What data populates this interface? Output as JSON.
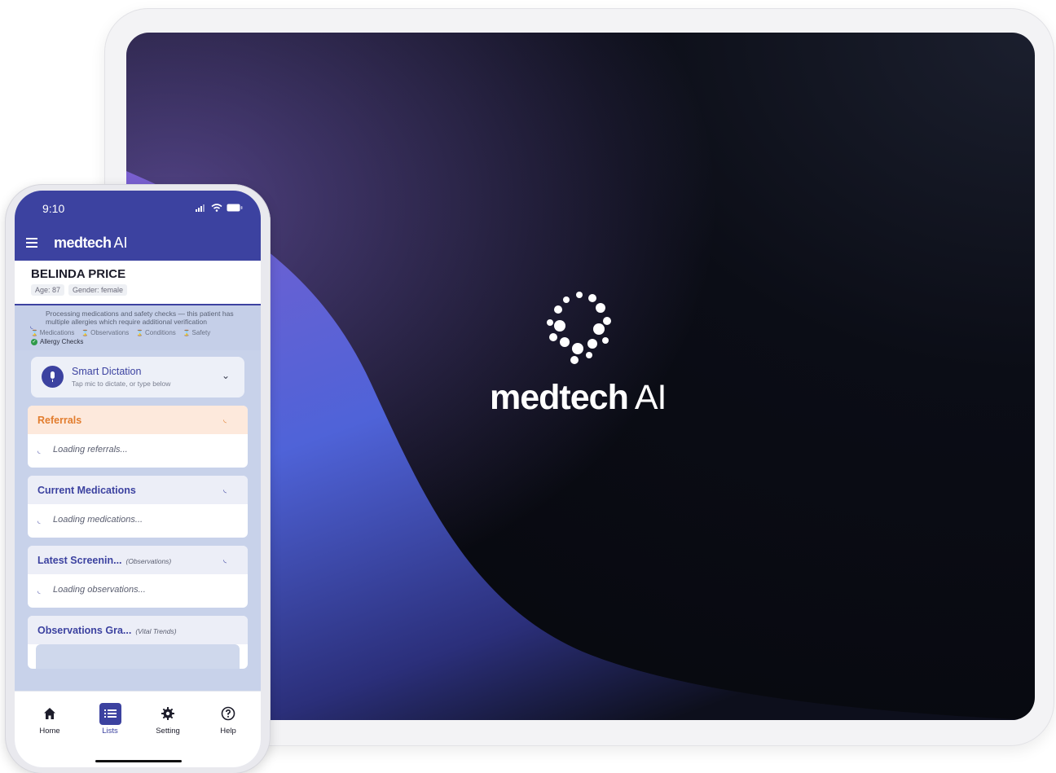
{
  "splash": {
    "brand_bold": "medtech",
    "brand_regular": "AI",
    "logo_icon": "dots-ring-icon"
  },
  "phone": {
    "status": {
      "time": "9:10"
    },
    "appbar": {
      "brand_bold": "medtech",
      "brand_regular": "AI",
      "menu_icon": "hamburger-icon"
    },
    "patient": {
      "name": "BELINDA PRICE",
      "age": "Age: 87",
      "gender": "Gender: female"
    },
    "processing": {
      "message": "Processing medications and safety checks — this patient has multiple allergies which require additional verification",
      "steps": [
        "Medications",
        "Observations",
        "Conditions",
        "Safety"
      ],
      "done": "Allergy Checks"
    },
    "dictation": {
      "title": "Smart Dictation",
      "subtitle": "Tap mic to dictate, or type below"
    },
    "cards": [
      {
        "title": "Referrals",
        "subtitle": "",
        "loading": "Loading referrals..."
      },
      {
        "title": "Current Medications",
        "subtitle": "",
        "loading": "Loading medications..."
      },
      {
        "title": "Latest Screenin...",
        "subtitle": "(Observations)",
        "loading": "Loading observations..."
      },
      {
        "title": "Observations Gra...",
        "subtitle": "(Vital Trends)",
        "loading": ""
      }
    ],
    "nav": [
      {
        "label": "Home",
        "icon": "home-icon"
      },
      {
        "label": "Lists",
        "icon": "list-icon"
      },
      {
        "label": "Setting",
        "icon": "gear-icon"
      },
      {
        "label": "Help",
        "icon": "help-icon"
      }
    ],
    "active_nav": "Lists",
    "colors": {
      "primary": "#3c42a0",
      "referral_accent": "#e27d2e"
    }
  }
}
